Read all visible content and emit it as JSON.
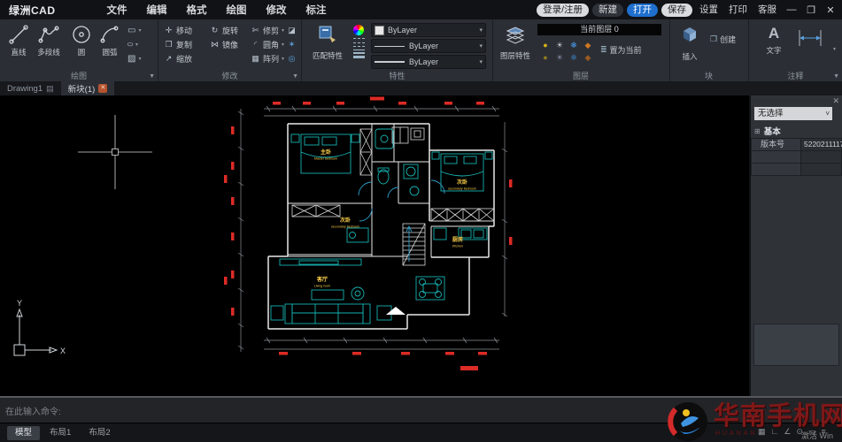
{
  "title_bar": {
    "app_name": "绿洲CAD",
    "menus": [
      "文件",
      "编辑",
      "格式",
      "绘图",
      "修改",
      "标注"
    ],
    "login_label": "登录/注册",
    "new_label": "新建",
    "open_label": "打开",
    "save_label": "保存",
    "settings_label": "设置",
    "print_label": "打印",
    "support_label": "客服"
  },
  "ribbon": {
    "draw": {
      "label": "绘图",
      "tools": [
        {
          "label": "直线"
        },
        {
          "label": "多段线"
        },
        {
          "label": "圆"
        },
        {
          "label": "圆弧"
        }
      ]
    },
    "modify": {
      "label": "修改",
      "row1": [
        "移动",
        "旋转",
        "修剪"
      ],
      "row2": [
        "复制",
        "镜像",
        "圆角"
      ],
      "row3": [
        "缩放",
        "阵列"
      ]
    },
    "properties": {
      "label": "特性",
      "match_label": "匹配特性",
      "color_value": "ByLayer",
      "linetype_value": "ByLayer",
      "lineweight_value": "ByLayer"
    },
    "layers": {
      "label": "图层",
      "props_label": "图层特性",
      "current_layer": "当前图层 0",
      "set_current_label": "置为当前"
    },
    "block": {
      "label": "块",
      "insert_label": "插入",
      "create_label": "创建"
    },
    "annotation": {
      "label": "注释",
      "text_label": "文字"
    }
  },
  "file_tabs": {
    "tab1": "Drawing1",
    "tab2": "新块(1)"
  },
  "canvas": {
    "rooms": {
      "master": {
        "cn": "主卧",
        "en": "Master bedroom"
      },
      "bedroom2": {
        "cn": "次卧",
        "en": "secondary bedroom"
      },
      "bedroom3": {
        "cn": "次卧",
        "en": "secondary bedroom"
      },
      "living": {
        "cn": "客厅",
        "en": "Living room"
      },
      "kitchen": {
        "cn": "厨房",
        "en": "Kitchen"
      }
    },
    "ucs": {
      "x_label": "X",
      "y_label": "Y"
    }
  },
  "inspector": {
    "selection_value": "无选择",
    "section_label": "基本",
    "rows": [
      {
        "label": "版本号",
        "value": "5220211117"
      }
    ]
  },
  "command_line": {
    "prompt": "在此输入命令:"
  },
  "status_bar": {
    "tabs": [
      "模型",
      "布局1",
      "布局2"
    ]
  },
  "watermark": {
    "brand": "华南手机网",
    "sub": "HUANAN",
    "activate": "激活 Win"
  },
  "icons": {
    "min": "—",
    "max": "❐",
    "close": "✕",
    "caret": "▾",
    "select_caret": "˅",
    "sheet": "▤",
    "overflow": "▼",
    "move": "✛",
    "rotate": "↻",
    "trim": "✄",
    "copy": "❐",
    "mirror": "⋈",
    "fillet": "◜",
    "scale": "↗",
    "array": "▦",
    "erase": "◪",
    "explode": "✶",
    "offset": "◎",
    "rect_tool": "▭",
    "ellipse_tool": "○",
    "hatch_tool": "▨",
    "bulb": "●",
    "sun": "☀",
    "freeze": "❄",
    "lock": "◆",
    "layers_set": "≣",
    "create": "❐",
    "text_glyph": "A",
    "section_box": "⊞",
    "status_glyphs": [
      "▦",
      "∟",
      "∠",
      "⊙",
      "▭",
      "≡"
    ]
  },
  "colors": {
    "accent_blue": "#1f6fce",
    "dim_red": "#dd2b26",
    "furniture_teal": "#17b3b3",
    "label_yellow": "#ffd24a",
    "wall_white": "#e9e9e9",
    "watermark_red": "#7e1818"
  }
}
